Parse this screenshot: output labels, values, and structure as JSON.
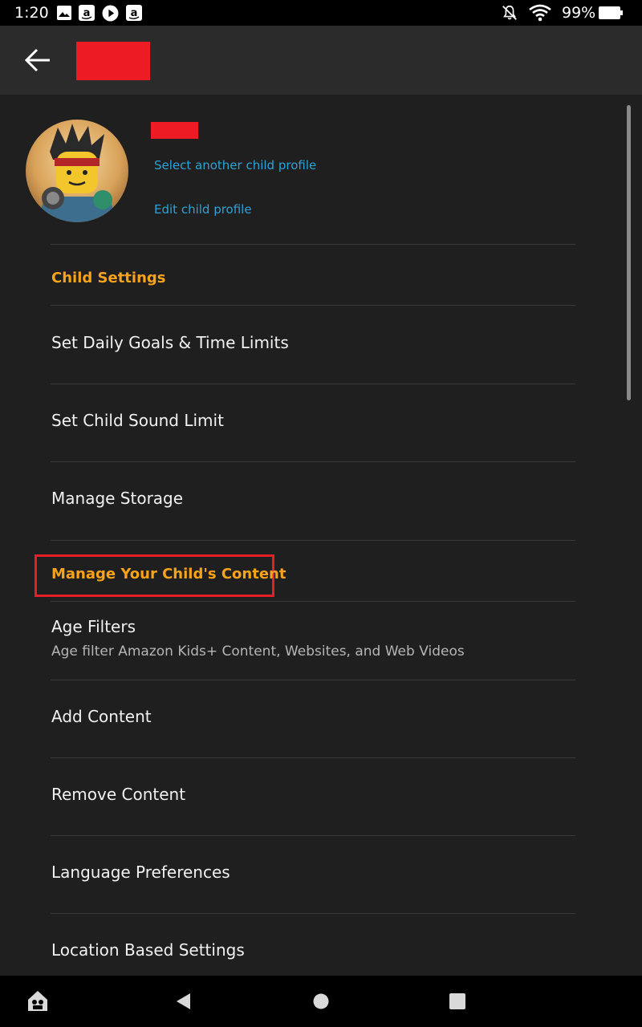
{
  "status_bar": {
    "time": "1:20",
    "battery": "99%",
    "notification_icons": [
      "image-icon",
      "amazon-icon",
      "play-icon",
      "amazon-icon"
    ]
  },
  "app_bar": {
    "title": ""
  },
  "profile": {
    "select_another": "Select another child profile",
    "edit": "Edit child profile"
  },
  "sections": {
    "child_settings": "Child Settings",
    "manage_content": "Manage Your Child's Content"
  },
  "child_settings_items": [
    "Set Daily Goals & Time Limits",
    "Set Child Sound Limit",
    "Manage Storage"
  ],
  "content_items": {
    "age_filters": {
      "label": "Age Filters",
      "subtitle": "Age filter Amazon Kids+ Content, Websites, and Web Videos"
    },
    "add_content": "Add Content",
    "remove_content": "Remove Content",
    "language_preferences": "Language Preferences",
    "location_settings": "Location Based Settings"
  },
  "colors": {
    "accent": "#f7a21b",
    "link": "#2aa3d8",
    "highlight": "#e41f26",
    "redaction": "#ed1c24"
  }
}
